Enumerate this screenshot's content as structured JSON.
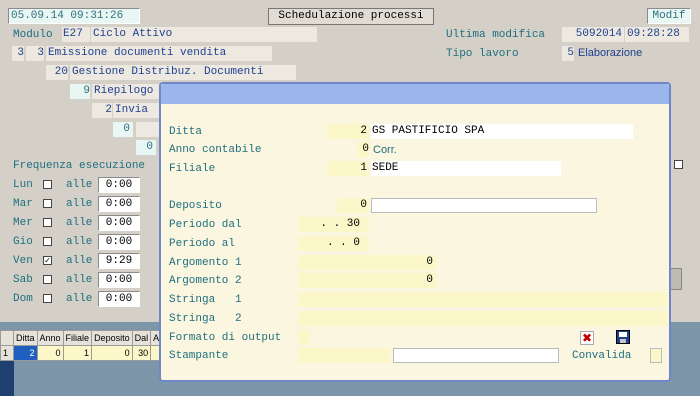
{
  "header": {
    "datetime": "05.09.14 09:31:26",
    "title_button": "Schedulazione processi",
    "mode_button": "Modif"
  },
  "main": {
    "modulo_label": "Modulo",
    "modulo_code": "E27",
    "modulo_desc": "Ciclo Attivo",
    "ultima_modifica_label": "Ultima modifica",
    "ultima_modifica_date": "5092014",
    "ultima_modifica_time": "09:28:28",
    "tipo_lavoro_label": "Tipo lavoro",
    "tipo_lavoro_code": "5",
    "tipo_lavoro_desc": "Elaborazione",
    "tree": [
      {
        "n1": "3",
        "n2": "3",
        "desc": "Emissione documenti vendita"
      },
      {
        "n": "20",
        "desc": "Gestione Distribuz. Documenti"
      },
      {
        "n": "9",
        "desc": "Riepilogo"
      },
      {
        "n": "2",
        "desc": "Invia"
      }
    ],
    "zero_a": "0",
    "zero_b": "0",
    "frequenza_label": "Frequenza esecuzione",
    "days": [
      {
        "day": "Lun",
        "checked": "",
        "alle": "alle",
        "time": "0:00"
      },
      {
        "day": "Mar",
        "checked": "",
        "alle": "alle",
        "time": "0:00"
      },
      {
        "day": "Mer",
        "checked": "",
        "alle": "alle",
        "time": "0:00"
      },
      {
        "day": "Gio",
        "checked": "",
        "alle": "alle",
        "time": "0:00"
      },
      {
        "day": "Ven",
        "checked": "✓",
        "alle": "alle",
        "time": "9:29"
      },
      {
        "day": "Sab",
        "checked": "",
        "alle": "alle",
        "time": "0:00"
      },
      {
        "day": "Dom",
        "checked": "",
        "alle": "alle",
        "time": "0:00"
      }
    ]
  },
  "grid": {
    "headers": [
      "Ditta",
      "Anno",
      "Filiale",
      "Deposito",
      "Dal",
      "A"
    ],
    "row": {
      "idx": "1",
      "ditta": "2",
      "anno": "0",
      "filiale": "1",
      "deposito": "0",
      "dal": "30"
    }
  },
  "dialog": {
    "ditta_label": "Ditta",
    "ditta_code": "2",
    "ditta_name": "GS PASTIFICIO SPA",
    "anno_label": "Anno contabile",
    "anno_value": "0",
    "anno_extra": "Corr.",
    "filiale_label": "Filiale",
    "filiale_code": "1",
    "filiale_name": "SEDE",
    "deposito_label": "Deposito",
    "deposito_value": "0",
    "periodo_dal_label": "Periodo dal",
    "periodo_dal_value": ". .   30",
    "periodo_al_label": "Periodo  al",
    "periodo_al_value": ". .    0",
    "arg1_label": "Argomento 1",
    "arg1_value": "0",
    "arg2_label": "Argomento 2",
    "arg2_value": "0",
    "str1_label": "Stringa   1",
    "str2_label": "Stringa   2",
    "formato_label": "Formato di output",
    "stampante_label": "Stampante",
    "convalida_label": "Convalida"
  },
  "colors": {
    "dialog_border": "#6f86c8",
    "dialog_header": "#9bb6ec",
    "dialog_bg": "#fbf6df",
    "field_yellow": "#fbf7c8"
  }
}
